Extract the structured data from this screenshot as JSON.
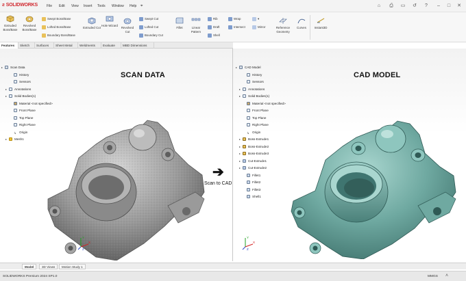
{
  "app": {
    "logo": "SOLIDWORKS"
  },
  "menu": [
    "File",
    "Edit",
    "View",
    "Insert",
    "Tools",
    "Window",
    "Help"
  ],
  "ribbon": {
    "extruded_boss": "Extruded Boss/Base",
    "revolved_boss": "Revolved Boss/Base",
    "swept_boss": "Swept Boss/Base",
    "lofted_boss": "Lofted Boss/Base",
    "boundary_boss": "Boundary Boss/Base",
    "extruded_cut": "Extruded Cut",
    "hole_wizard": "Hole Wizard",
    "revolved_cut": "Revolved Cut",
    "swept_cut": "Swept Cut",
    "lofted_cut": "Lofted Cut",
    "boundary_cut": "Boundary Cut",
    "fillet": "Fillet",
    "linear_pattern": "Linear Pattern",
    "rib": "Rib",
    "draft": "Draft",
    "shell": "Shell",
    "wrap": "Wrap",
    "intersect": "Intersect",
    "mirror": "Mirror",
    "reference_geometry": "Reference Geometry",
    "curves": "Curves",
    "instant3d": "Instant3D"
  },
  "tabs": [
    "Features",
    "Sketch",
    "Surfaces",
    "Sheet Metal",
    "Weldments",
    "Evaluate",
    "MBD Dimensions"
  ],
  "left_tree": {
    "root": "Scan Data",
    "items": [
      "History",
      "Sensors",
      "Annotations",
      "Solid Bodies(1)",
      "Material <not specified>",
      "Front Plane",
      "Top Plane",
      "Right Plane",
      "Origin",
      "Mesh1"
    ]
  },
  "right_tree": {
    "root": "CAD Model",
    "items": [
      "History",
      "Sensors",
      "Annotations",
      "Solid Bodies(1)",
      "Material <not specified>",
      "Front Plane",
      "Top Plane",
      "Right Plane",
      "Origin",
      "Boss-Extrude1",
      "Boss-Extrude2",
      "Boss-Extrude3",
      "Cut-Extrude1",
      "Cut-Extrude2",
      "Fillet1",
      "Fillet2",
      "Fillet3",
      "Shell1"
    ]
  },
  "headings": {
    "left": "SCAN DATA",
    "right": "CAD MODEL"
  },
  "overlay": {
    "caption": "Scan to CAD",
    "arrow": "➔"
  },
  "triad": {
    "x": "X",
    "y": "Y",
    "z": "Z"
  },
  "bottom_tabs": [
    "Model",
    "3D Views",
    "Motion Study 1"
  ],
  "status": {
    "product": "SOLIDWORKS Premium 2024 SP1.0",
    "units": "MMGS"
  },
  "colors": {
    "brand": "#d0272e",
    "cad_model": "#5f9c95",
    "scan_mesh": "#8e8e8e",
    "axis_x": "#d42020",
    "axis_y": "#1fa11f",
    "axis_z": "#2946c9"
  }
}
